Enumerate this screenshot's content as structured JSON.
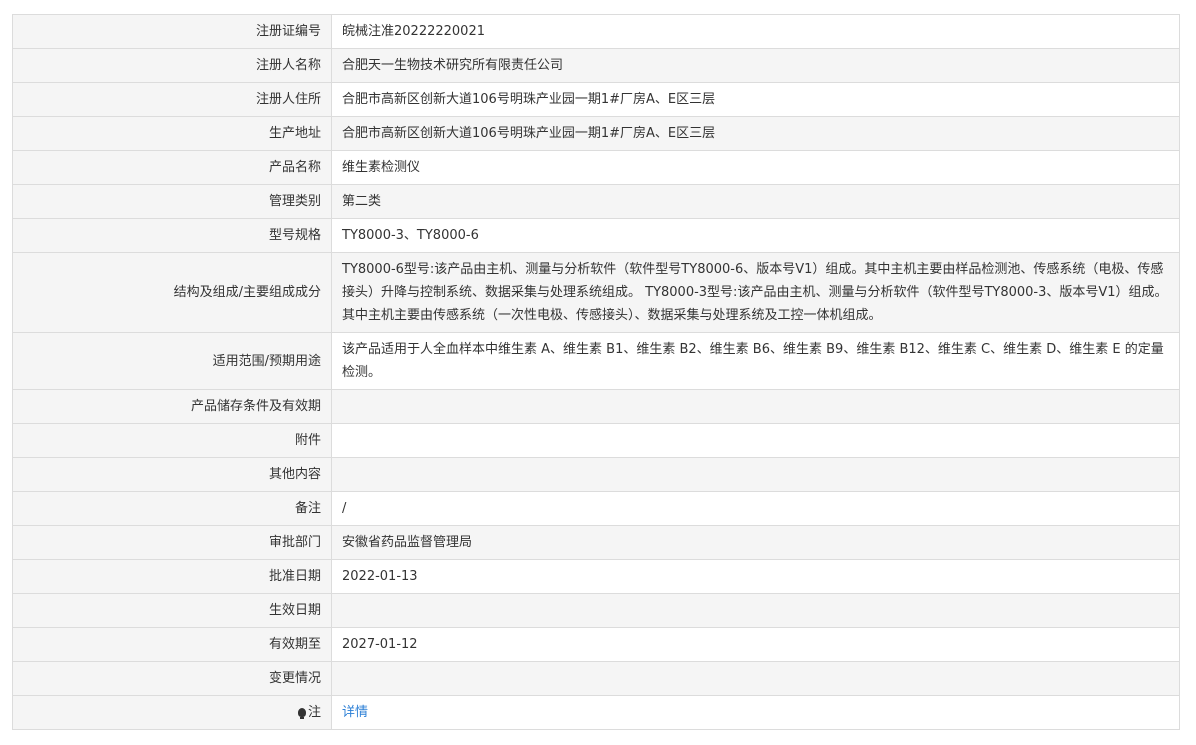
{
  "rows": [
    {
      "label": "注册证编号",
      "value": "皖械注准20222220021"
    },
    {
      "label": "注册人名称",
      "value": "合肥天一生物技术研究所有限责任公司"
    },
    {
      "label": "注册人住所",
      "value": "合肥市高新区创新大道106号明珠产业园一期1#厂房A、E区三层"
    },
    {
      "label": "生产地址",
      "value": "合肥市高新区创新大道106号明珠产业园一期1#厂房A、E区三层"
    },
    {
      "label": "产品名称",
      "value": "维生素检测仪"
    },
    {
      "label": "管理类别",
      "value": "第二类"
    },
    {
      "label": "型号规格",
      "value": "TY8000-3、TY8000-6"
    },
    {
      "label": "结构及组成/主要组成成分",
      "value": "TY8000-6型号:该产品由主机、测量与分析软件（软件型号TY8000-6、版本号V1）组成。其中主机主要由样品检测池、传感系统（电极、传感接头）升降与控制系统、数据采集与处理系统组成。 TY8000-3型号:该产品由主机、测量与分析软件（软件型号TY8000-3、版本号V1）组成。其中主机主要由传感系统（一次性电极、传感接头）、数据采集与处理系统及工控一体机组成。"
    },
    {
      "label": "适用范围/预期用途",
      "value": "该产品适用于人全血样本中维生素 A、维生素 B1、维生素 B2、维生素 B6、维生素 B9、维生素 B12、维生素 C、维生素 D、维生素 E 的定量检测。"
    },
    {
      "label": "产品储存条件及有效期",
      "value": ""
    },
    {
      "label": "附件",
      "value": ""
    },
    {
      "label": "其他内容",
      "value": ""
    },
    {
      "label": "备注",
      "value": "/"
    },
    {
      "label": "审批部门",
      "value": "安徽省药品监督管理局"
    },
    {
      "label": "批准日期",
      "value": "2022-01-13"
    },
    {
      "label": "生效日期",
      "value": ""
    },
    {
      "label": "有效期至",
      "value": "2027-01-12"
    },
    {
      "label": "变更情况",
      "value": ""
    }
  ],
  "note": {
    "icon": "lightbulb-icon",
    "label": "注",
    "link_text": "详情",
    "link_color": "#2c7fd6"
  }
}
